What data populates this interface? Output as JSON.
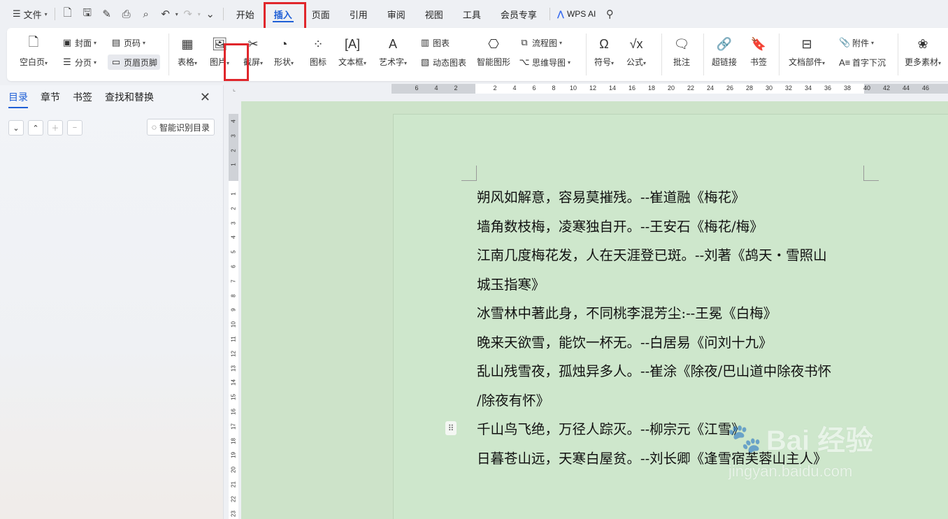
{
  "menubar": {
    "file_label": "文件",
    "tabs": [
      "开始",
      "插入",
      "页面",
      "引用",
      "审阅",
      "视图",
      "工具",
      "会员专享"
    ],
    "active_tab": "插入",
    "wps_ai_label": "WPS AI"
  },
  "ribbon": {
    "blank_page": "空白页",
    "cover": "封面",
    "page_break": "分页",
    "page_number": "页码",
    "header_footer": "页眉页脚",
    "table": "表格",
    "picture": "图片",
    "screenshot": "截屏",
    "shape": "形状",
    "icon": "图标",
    "textbox": "文本框",
    "wordart": "艺术字",
    "chart": "图表",
    "dynamic_chart": "动态图表",
    "smartart": "智能图形",
    "flowchart": "流程图",
    "mindmap": "思维导图",
    "symbol": "符号",
    "formula": "公式",
    "comment": "批注",
    "hyperlink": "超链接",
    "bookmark": "书签",
    "doc_parts": "文档部件",
    "attachment": "附件",
    "drop_cap": "首字下沉",
    "more_material": "更多素材"
  },
  "leftpane": {
    "tabs": [
      "目录",
      "章节",
      "书签",
      "查找和替换"
    ],
    "active_tab": "目录",
    "smart_toc_button": "智能识别目录"
  },
  "ruler": {
    "h_ticks": [
      "6",
      "4",
      "2",
      "",
      "2",
      "4",
      "6",
      "8",
      "10",
      "12",
      "14",
      "16",
      "18",
      "20",
      "22",
      "24",
      "26",
      "28",
      "30",
      "32",
      "34",
      "36",
      "38",
      "40",
      "42",
      "44",
      "46"
    ],
    "v_ticks": [
      "4",
      "3",
      "2",
      "1",
      "",
      "1",
      "2",
      "3",
      "4",
      "5",
      "6",
      "7",
      "8",
      "9",
      "10",
      "11",
      "12",
      "13",
      "14",
      "15",
      "16",
      "17",
      "18",
      "19",
      "20",
      "21",
      "22",
      "23"
    ]
  },
  "document": {
    "lines": [
      "朔风如解意，容易莫摧残。--崔道融《梅花》",
      "墙角数枝梅，凌寒独自开。--王安石《梅花/梅》",
      "江南几度梅花发，人在天涯登已斑。--刘著《鸪天・雪照山",
      "城玉指寒》",
      "冰雪林中著此身，不同桃李混芳尘:--王冕《白梅》",
      "晚来天欲雪，能饮一杯无。--白居易《问刘十九》",
      "乱山残雪夜，孤烛异多人。--崔涂《除夜/巴山道中除夜书怀",
      "/除夜有怀》",
      "千山鸟飞绝，万径人踪灭。--柳宗元《江雪》",
      "日暮苍山远，天寒白屋贫。--刘长卿《逢雪宿芙蓉山主人》"
    ]
  },
  "watermark": {
    "logo_text": "Bai 经验",
    "url": "jingyan.baidu.com"
  },
  "colors": {
    "accent": "#1f5fd6",
    "highlight_box": "#e0262b",
    "doc_background": "#cee7cc"
  }
}
